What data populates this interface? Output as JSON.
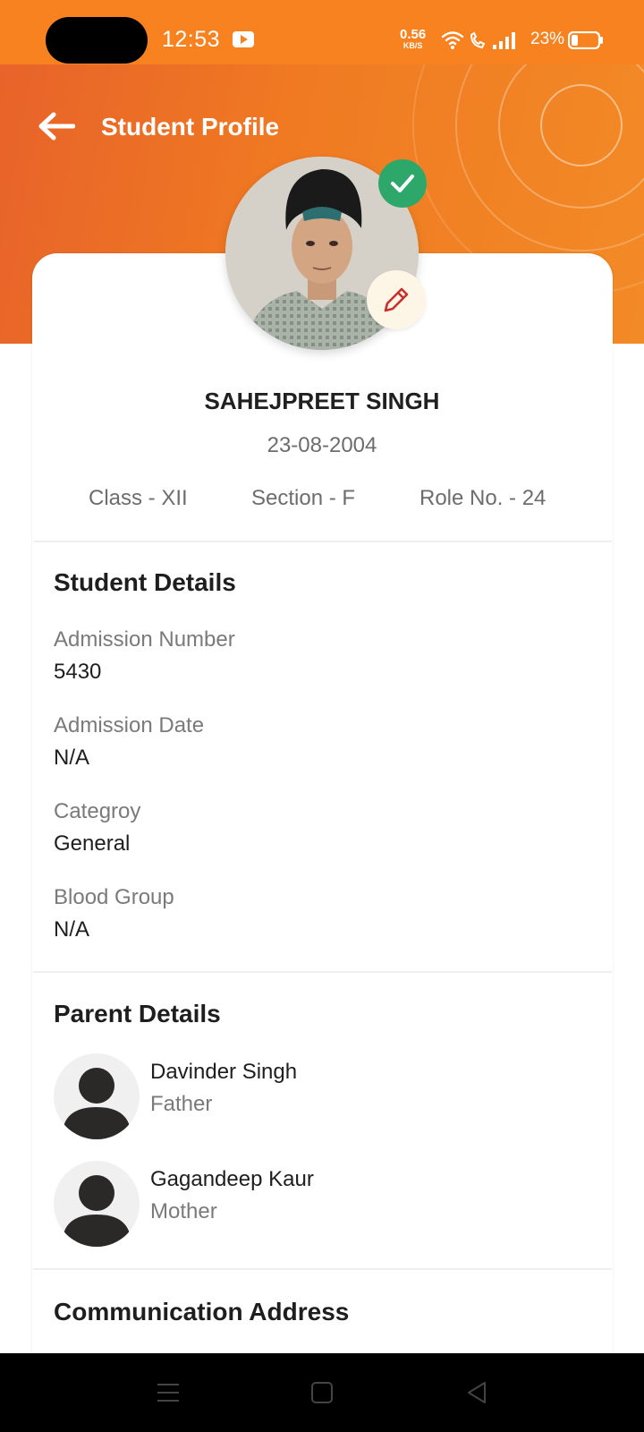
{
  "status_bar": {
    "time": "12:53",
    "net_speed": "0.56",
    "net_unit": "KB/S",
    "battery": "23%"
  },
  "app_bar": {
    "title": "Student Profile",
    "back_icon": "arrow-left-icon"
  },
  "profile": {
    "name": "SAHEJPREET SINGH",
    "dob": "23-08-2004",
    "class": "Class - XII",
    "section": "Section - F",
    "roll": "Role No. - 24",
    "verified_icon": "check-icon",
    "edit_icon": "pencil-icon"
  },
  "student_details": {
    "title": "Student Details",
    "fields": [
      {
        "label": "Admission Number",
        "value": "5430"
      },
      {
        "label": "Admission Date",
        "value": "N/A"
      },
      {
        "label": "Categroy",
        "value": "General"
      },
      {
        "label": "Blood Group",
        "value": "N/A"
      }
    ]
  },
  "parent_details": {
    "title": "Parent Details",
    "parents": [
      {
        "name": "Davinder Singh",
        "relation": "Father"
      },
      {
        "name": "Gagandeep Kaur",
        "relation": "Mother"
      }
    ]
  },
  "communication": {
    "title": "Communication Address"
  },
  "nav": {
    "menu_icon": "menu-icon",
    "home_icon": "square-home-icon",
    "back_icon": "triangle-back-icon"
  },
  "colors": {
    "accent": "#f07a22",
    "verified": "#2ea86a",
    "edit_icon": "#c9302c"
  }
}
